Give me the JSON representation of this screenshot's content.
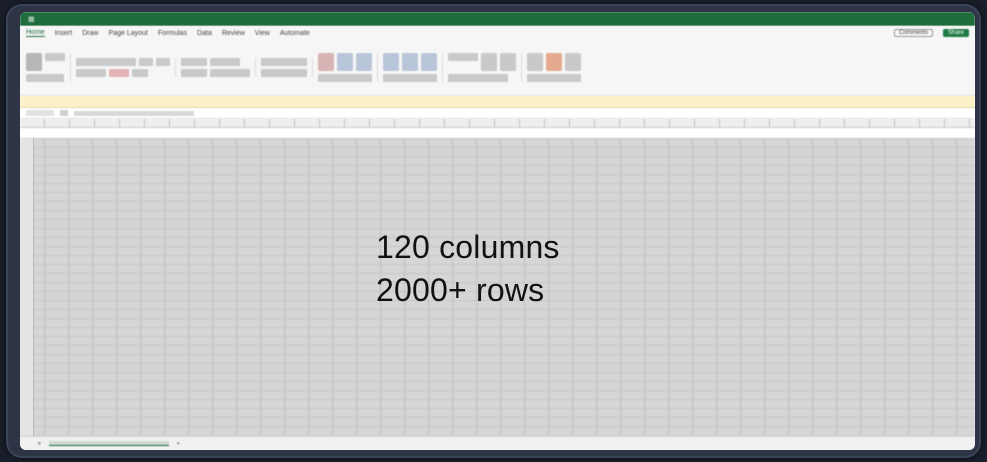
{
  "window": {
    "title": "",
    "menu_tabs": [
      "Home",
      "Insert",
      "Draw",
      "Page Layout",
      "Formulas",
      "Data",
      "Review",
      "View",
      "Automate"
    ],
    "comments_label": "Comments",
    "share_label": "Share"
  },
  "overlay": {
    "line1": "120 columns",
    "line2": "2000+ rows"
  },
  "colors": {
    "excel_green": "#1f6c3d",
    "frame": "#2c3446",
    "grid": "#d6d6d6"
  }
}
